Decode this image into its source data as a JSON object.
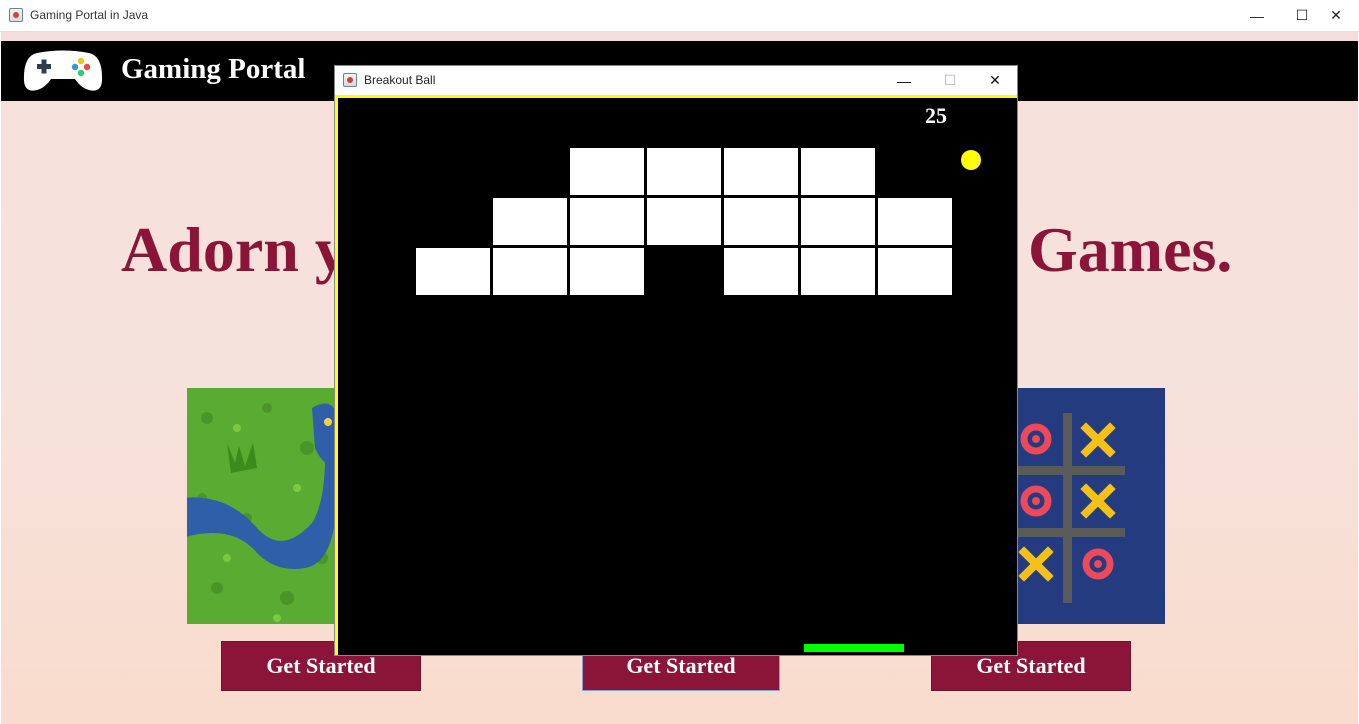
{
  "window": {
    "title": "Gaming Portal in Java",
    "controls": [
      "—",
      "☐",
      "✕"
    ]
  },
  "header": {
    "brand": "Gaming Portal"
  },
  "hero": {
    "headline_left": "Adorn y",
    "headline_right": "Games."
  },
  "cards": [
    {
      "name": "snake",
      "button": "Get Started"
    },
    {
      "name": "breakout",
      "button": "Get Started"
    },
    {
      "name": "tictactoe",
      "button": "Get Started"
    }
  ],
  "breakout": {
    "title": "Breakout Ball",
    "controls": [
      "—",
      "☐",
      "✕"
    ],
    "score": "25",
    "brick_rows": [
      [
        0,
        0,
        1,
        1,
        1,
        1,
        0
      ],
      [
        0,
        1,
        1,
        1,
        1,
        1,
        1
      ],
      [
        1,
        1,
        1,
        0,
        1,
        1,
        1
      ]
    ],
    "colors": {
      "border": "#ffff00",
      "ball": "#ffff00",
      "paddle": "#00ff00",
      "brick": "#ffffff",
      "accent": "#8b1538"
    }
  }
}
